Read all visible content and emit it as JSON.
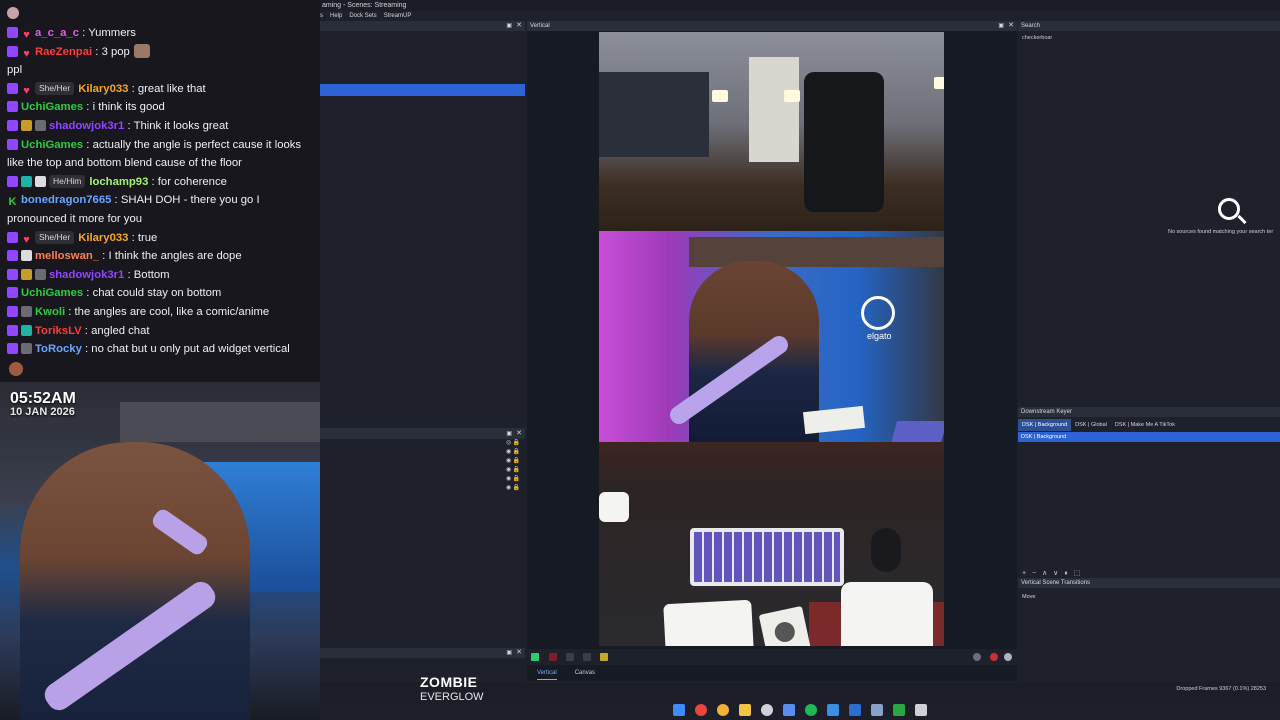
{
  "chat": {
    "messages": [
      {
        "user": "a_c_a_c",
        "color": "#e65ce6",
        "text": "Yummers",
        "pronouns": "",
        "badges": [
          "sub",
          "heart"
        ]
      },
      {
        "user": "RaeZenpai",
        "color": "#ff3b3b",
        "text": "3 pop",
        "pronouns": "",
        "badges": [
          "sub",
          "heart"
        ]
      },
      {
        "user": "",
        "color": "#f0f0f0",
        "text": "ppl",
        "pronouns": "",
        "badges": []
      },
      {
        "user": "Kilary033",
        "color": "#f5a623",
        "text": "great like that",
        "pronouns": "She/Her",
        "badges": [
          "sub",
          "heart"
        ]
      },
      {
        "user": "UchiGames",
        "color": "#2ecc40",
        "text": "i think its good",
        "pronouns": "",
        "badges": [
          "sub"
        ]
      },
      {
        "user": "shadowjok3r1",
        "color": "#9146ff",
        "text": "Think it looks great",
        "pronouns": "",
        "badges": [
          "sub",
          "gold",
          "gray"
        ]
      },
      {
        "user": "UchiGames",
        "color": "#2ecc40",
        "text": "actually the angle is perfect cause it looks like the top and bottom blend cause of the floor",
        "pronouns": "",
        "badges": [
          "sub"
        ]
      },
      {
        "user": "lochamp93",
        "color": "#a4f26c",
        "text": "for coherence",
        "pronouns": "He/Him",
        "badges": [
          "sub",
          "teal",
          "white"
        ]
      },
      {
        "user": "bonedragon7665",
        "color": "#6aa5ff",
        "text": "SHAH DOH - there you go I pronounced it more for you",
        "pronouns": "",
        "badges": [
          "k"
        ]
      },
      {
        "user": "Kilary033",
        "color": "#f5a623",
        "text": "true",
        "pronouns": "She/Her",
        "badges": [
          "sub",
          "heart"
        ]
      },
      {
        "user": "melloswan_",
        "color": "#ff7f50",
        "text": "I think the angles are dope",
        "pronouns": "",
        "badges": [
          "sub",
          "white"
        ]
      },
      {
        "user": "shadowjok3r1",
        "color": "#9146ff",
        "text": "Bottom",
        "pronouns": "",
        "badges": [
          "sub",
          "gold",
          "gray"
        ]
      },
      {
        "user": "UchiGames",
        "color": "#2ecc40",
        "text": "chat could stay on bottom",
        "pronouns": "",
        "badges": [
          "sub"
        ]
      },
      {
        "user": "Kwoli",
        "color": "#2ecc40",
        "text": "the angles are cool, like a comic/anime",
        "pronouns": "",
        "badges": [
          "sub",
          "gray"
        ]
      },
      {
        "user": "ToriksLV",
        "color": "#ff3b3b",
        "text": "angled chat",
        "pronouns": "",
        "badges": [
          "sub",
          "teal"
        ]
      },
      {
        "user": "ToRocky",
        "color": "#6aa5ff",
        "text": "no chat but u only put ad widget vertical",
        "pronouns": "",
        "badges": [
          "sub",
          "gray"
        ]
      }
    ]
  },
  "overlay": {
    "time": "05:52AM",
    "date": "10 JAN 2026",
    "now_playing_title": "ZOMBIE",
    "now_playing_artist": "EVERGLOW"
  },
  "obs": {
    "title": "aming - Scenes: Streaming",
    "menu": [
      "s",
      "Help",
      "Dock Sets",
      "StreamUP"
    ],
    "vertical_dock_title": "Vertical",
    "search_dock_title": "Search",
    "search_value": "checkerboar",
    "no_sources_text": "No sources found matching your search ter",
    "dsk_dock_title": "Downstream Keyer",
    "dsk_tabs": [
      "DSK | Background",
      "DSK | Global",
      "DSK | Make Me A TikTok"
    ],
    "dsk_selected_item": "DSK | Background",
    "transitions_tools": "+ − ∧ ∨ ⏸ ⬚",
    "transitions_title": "Vertical Scene Transitions",
    "transitions_item": "Move",
    "canvas_tabs": [
      "Vertical",
      "Canvas"
    ],
    "dropped_frames": "Dropped Frames 9367 (0.1%)",
    "dropped_frames_tail": "28253",
    "preview_logo_text": "elgato"
  },
  "colors": {
    "accent_selection": "#2e63d6",
    "dock_bg": "#1e212b",
    "chat_bg": "#18171d"
  },
  "icons": {
    "taskbar": [
      "windows-start-icon",
      "chrome-icon",
      "chrome-icon",
      "file-explorer-icon",
      "obs-icon",
      "streamdeck-icon",
      "spotify-icon",
      "app-icon",
      "app-icon",
      "app-icon",
      "app-icon",
      "app-icon"
    ]
  }
}
